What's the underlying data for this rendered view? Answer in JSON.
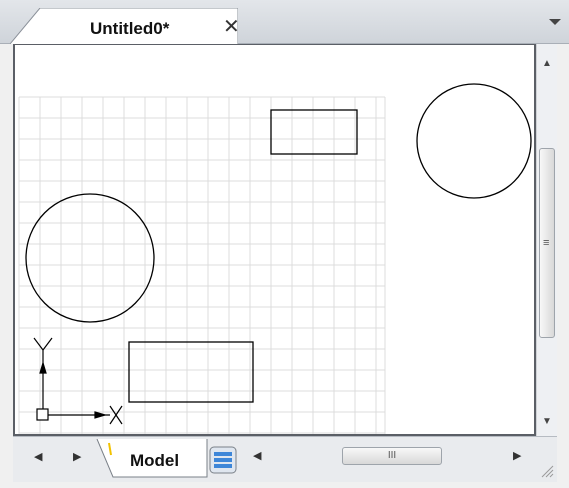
{
  "document_tab": {
    "title": "Untitled0*",
    "close_glyph": "✕"
  },
  "tab_menu_icon": "dropdown-arrow-icon",
  "layout_tabs": {
    "model_label": "Model"
  },
  "scrollbars": {
    "vertical_grip": "≡",
    "horizontal_grip": "III"
  },
  "colors": {
    "canvas": "#ffffff",
    "grid_line": "#dcdcdc",
    "shape_stroke": "#000000",
    "frame": "#f0f0f0"
  }
}
